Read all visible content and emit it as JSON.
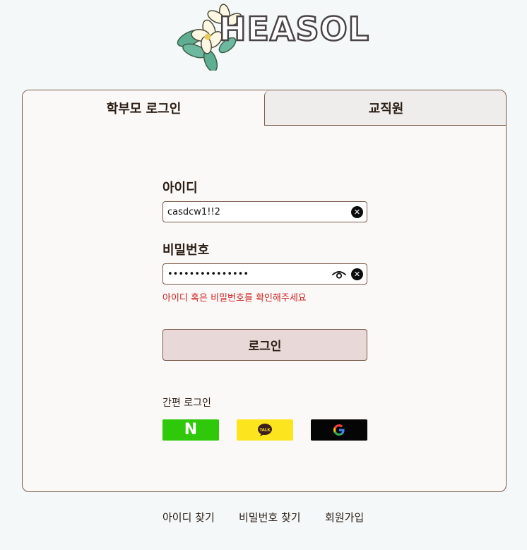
{
  "logo": {
    "text": "HEASOL",
    "icon": "flower-logo-icon"
  },
  "tabs": [
    {
      "label": "학부모 로그인",
      "active": true
    },
    {
      "label": "교직원",
      "active": false
    }
  ],
  "form": {
    "id_label": "아이디",
    "id_value": "casdcw1!!2",
    "password_label": "비밀번호",
    "password_value": "abcdefghijklmno",
    "error_message": "아이디 혹은 비밀번호를 확인해주세요",
    "login_button": "로그인"
  },
  "easy_login": {
    "label": "간편 로그인",
    "providers": [
      {
        "name": "naver",
        "glyph": "N",
        "color": "#2fc80a"
      },
      {
        "name": "kakao",
        "glyph": "TALK",
        "color": "#fce51e"
      },
      {
        "name": "google",
        "glyph": "G",
        "color": "#050505"
      }
    ]
  },
  "footer": {
    "find_id": "아이디 찾기",
    "find_password": "비밀번호 찾기",
    "signup": "회원가입"
  },
  "colors": {
    "page_bg": "#f4f8f9",
    "card_border": "#7a5a48",
    "error": "#cc1f1f",
    "login_button_bg": "#e8d9d8"
  }
}
